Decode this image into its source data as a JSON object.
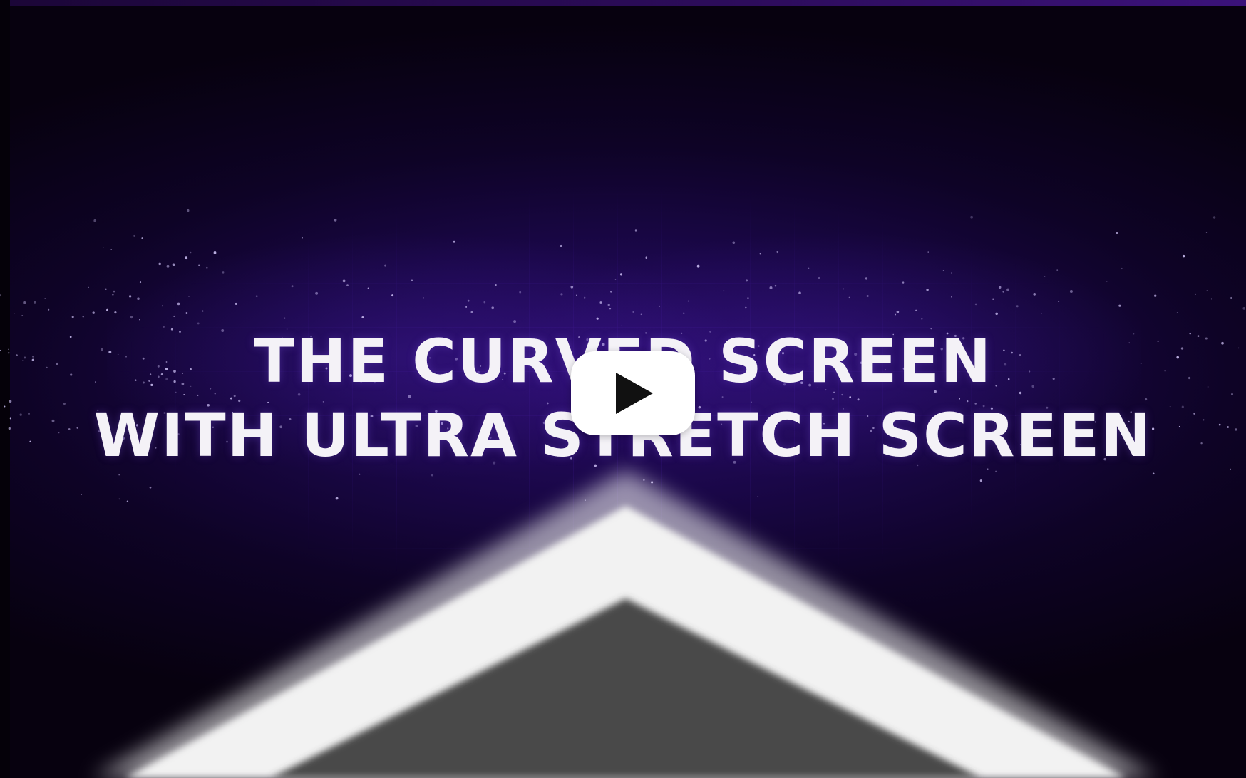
{
  "video": {
    "title_line_1": "THE CURVED SCREEN",
    "title_line_2": "WITH ULTRA STRETCH SCREEN",
    "play_icon": "play-icon"
  },
  "colors": {
    "background": "#1a0748",
    "title_text": "#f4f2f7",
    "play_button": "#ffffff",
    "play_glyph": "#111111",
    "screen_frame": "#ffffff",
    "screen_fill": "#4a4a4a"
  }
}
